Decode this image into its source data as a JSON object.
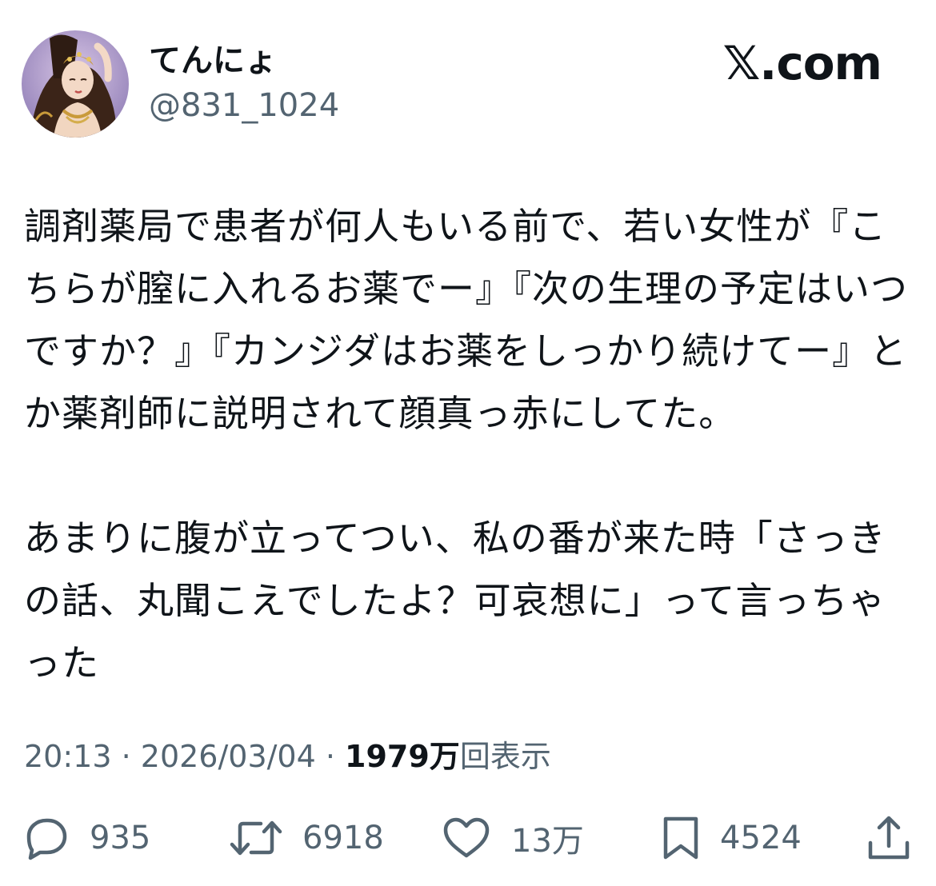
{
  "header": {
    "display_name": "てんにょ",
    "handle": "@831_1024",
    "brand": "𝕏.com"
  },
  "tweet": {
    "paragraphs": [
      "調剤薬局で患者が何人もいる前で、若い女性が『こちらが膣に入れるお薬でー』『次の生理の予定はいつですか？』『カンジダはお薬をしっかり続けてー』とか薬剤師に説明されて顔真っ赤にしてた。",
      "あまりに腹が立ってつい、私の番が来た時「さっきの話、丸聞こえでしたよ？可哀想に」って言っちゃった"
    ]
  },
  "meta": {
    "time": "20:13",
    "separator1": " · ",
    "date": "2026/03/04",
    "separator2": " · ",
    "views_count": "1979万",
    "views_label": "回表示"
  },
  "actions": {
    "reply": {
      "icon": "reply-icon",
      "count": "935"
    },
    "repost": {
      "icon": "repost-icon",
      "count": "6918"
    },
    "like": {
      "icon": "heart-icon",
      "count": "13万"
    },
    "bookmark": {
      "icon": "bookmark-icon",
      "count": "4524"
    },
    "share": {
      "icon": "share-icon"
    }
  },
  "colors": {
    "text": "#0f1419",
    "secondary": "#536471",
    "background": "#ffffff"
  }
}
